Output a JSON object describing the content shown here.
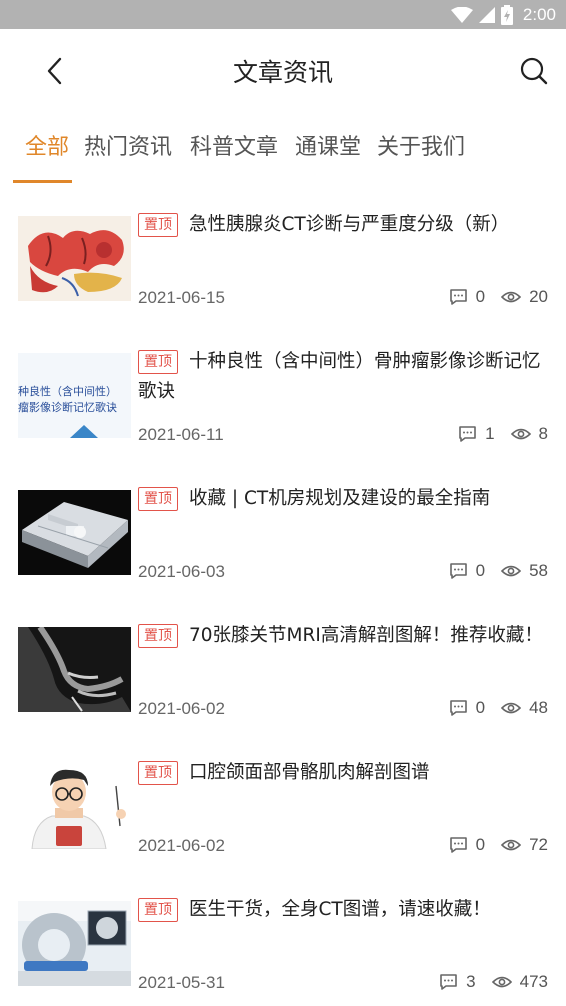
{
  "status_bar": {
    "time": "2:00"
  },
  "app_bar": {
    "title": "文章资讯"
  },
  "tabs": [
    {
      "label": "全部",
      "active": true
    },
    {
      "label": "热门资讯",
      "active": false
    },
    {
      "label": "科普文章",
      "active": false
    },
    {
      "label": "通课堂",
      "active": false
    },
    {
      "label": "关于我们",
      "active": false
    }
  ],
  "badge_label": "置顶",
  "articles": [
    {
      "title": "急性胰腺炎CT诊断与严重度分级（新）",
      "date": "2021-06-15",
      "comments": "0",
      "views": "20"
    },
    {
      "title_line1": "十种良性（含中间性）骨肿瘤影像诊断记忆",
      "title_line2": "歌诀",
      "thumb_text_1": "种良性（含中间性）",
      "thumb_text_2": "瘤影像诊断记忆歌诀",
      "date": "2021-06-11",
      "comments": "1",
      "views": "8"
    },
    {
      "title": "收藏 | CT机房规划及建设的最全指南",
      "date": "2021-06-03",
      "comments": "0",
      "views": "58"
    },
    {
      "title": "70张膝关节MRI高清解剖图解！推荐收藏！",
      "date": "2021-06-02",
      "comments": "0",
      "views": "48"
    },
    {
      "title": "口腔颌面部骨骼肌肉解剖图谱",
      "date": "2021-06-02",
      "comments": "0",
      "views": "72"
    },
    {
      "title": "医生干货，全身CT图谱，请速收藏！",
      "date": "2021-05-31",
      "comments": "3",
      "views": "473"
    }
  ],
  "icons": {
    "back": "chevron-left-icon",
    "search": "search-icon",
    "comment": "comment-icon",
    "view": "eye-icon"
  },
  "colors": {
    "accent": "#e0872a",
    "badge": "#e2534a",
    "status_bar": "#b2b2b2"
  }
}
